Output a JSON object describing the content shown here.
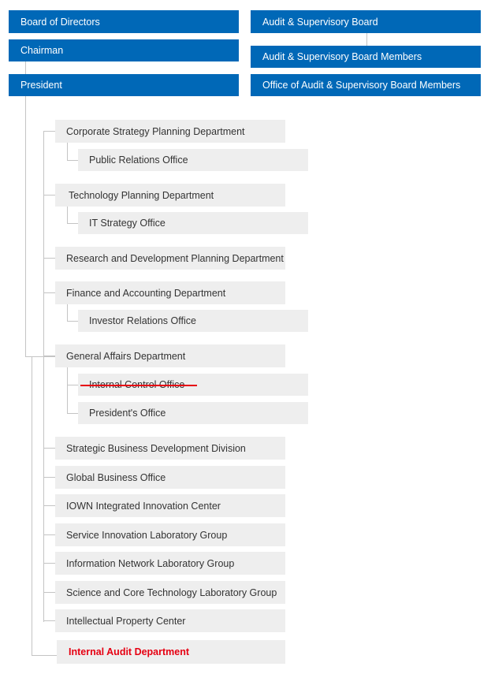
{
  "left_column": {
    "board": "Board of Directors",
    "chairman": "Chairman",
    "president": "President"
  },
  "right_column": {
    "audit_board": "Audit & Supervisory Board",
    "audit_members": "Audit & Supervisory Board Members",
    "audit_office": "Office of Audit & Supervisory Board Members"
  },
  "departments": [
    {
      "label": "Corporate Strategy Planning Department",
      "children": [
        "Public Relations Office"
      ]
    },
    {
      "label": "Technology Planning Department",
      "children": [
        "IT Strategy Office"
      ]
    },
    {
      "label": "Research and Development Planning Department",
      "children": []
    },
    {
      "label": "Finance and Accounting Department",
      "children": [
        "Investor Relations Office"
      ]
    },
    {
      "label": "General Affairs Department",
      "children": [
        "Internal Control Office",
        "President's Office"
      ],
      "struck_child": "Internal Control Office"
    },
    {
      "label": "Strategic Business Development Division",
      "children": []
    },
    {
      "label": "Global Business Office",
      "children": []
    },
    {
      "label": "IOWN Integrated Innovation Center",
      "children": []
    },
    {
      "label": "Service Innovation Laboratory Group",
      "children": []
    },
    {
      "label": "Information Network Laboratory Group",
      "children": []
    },
    {
      "label": "Science and Core Technology Laboratory Group",
      "children": []
    },
    {
      "label": "Intellectual Property Center",
      "children": []
    }
  ],
  "internal_audit": "Internal Audit Department",
  "colors": {
    "primary_blue": "#0068b7",
    "highlight_red": "#e60012",
    "box_gray": "#eeeeee",
    "connector": "#c4c4c4"
  }
}
